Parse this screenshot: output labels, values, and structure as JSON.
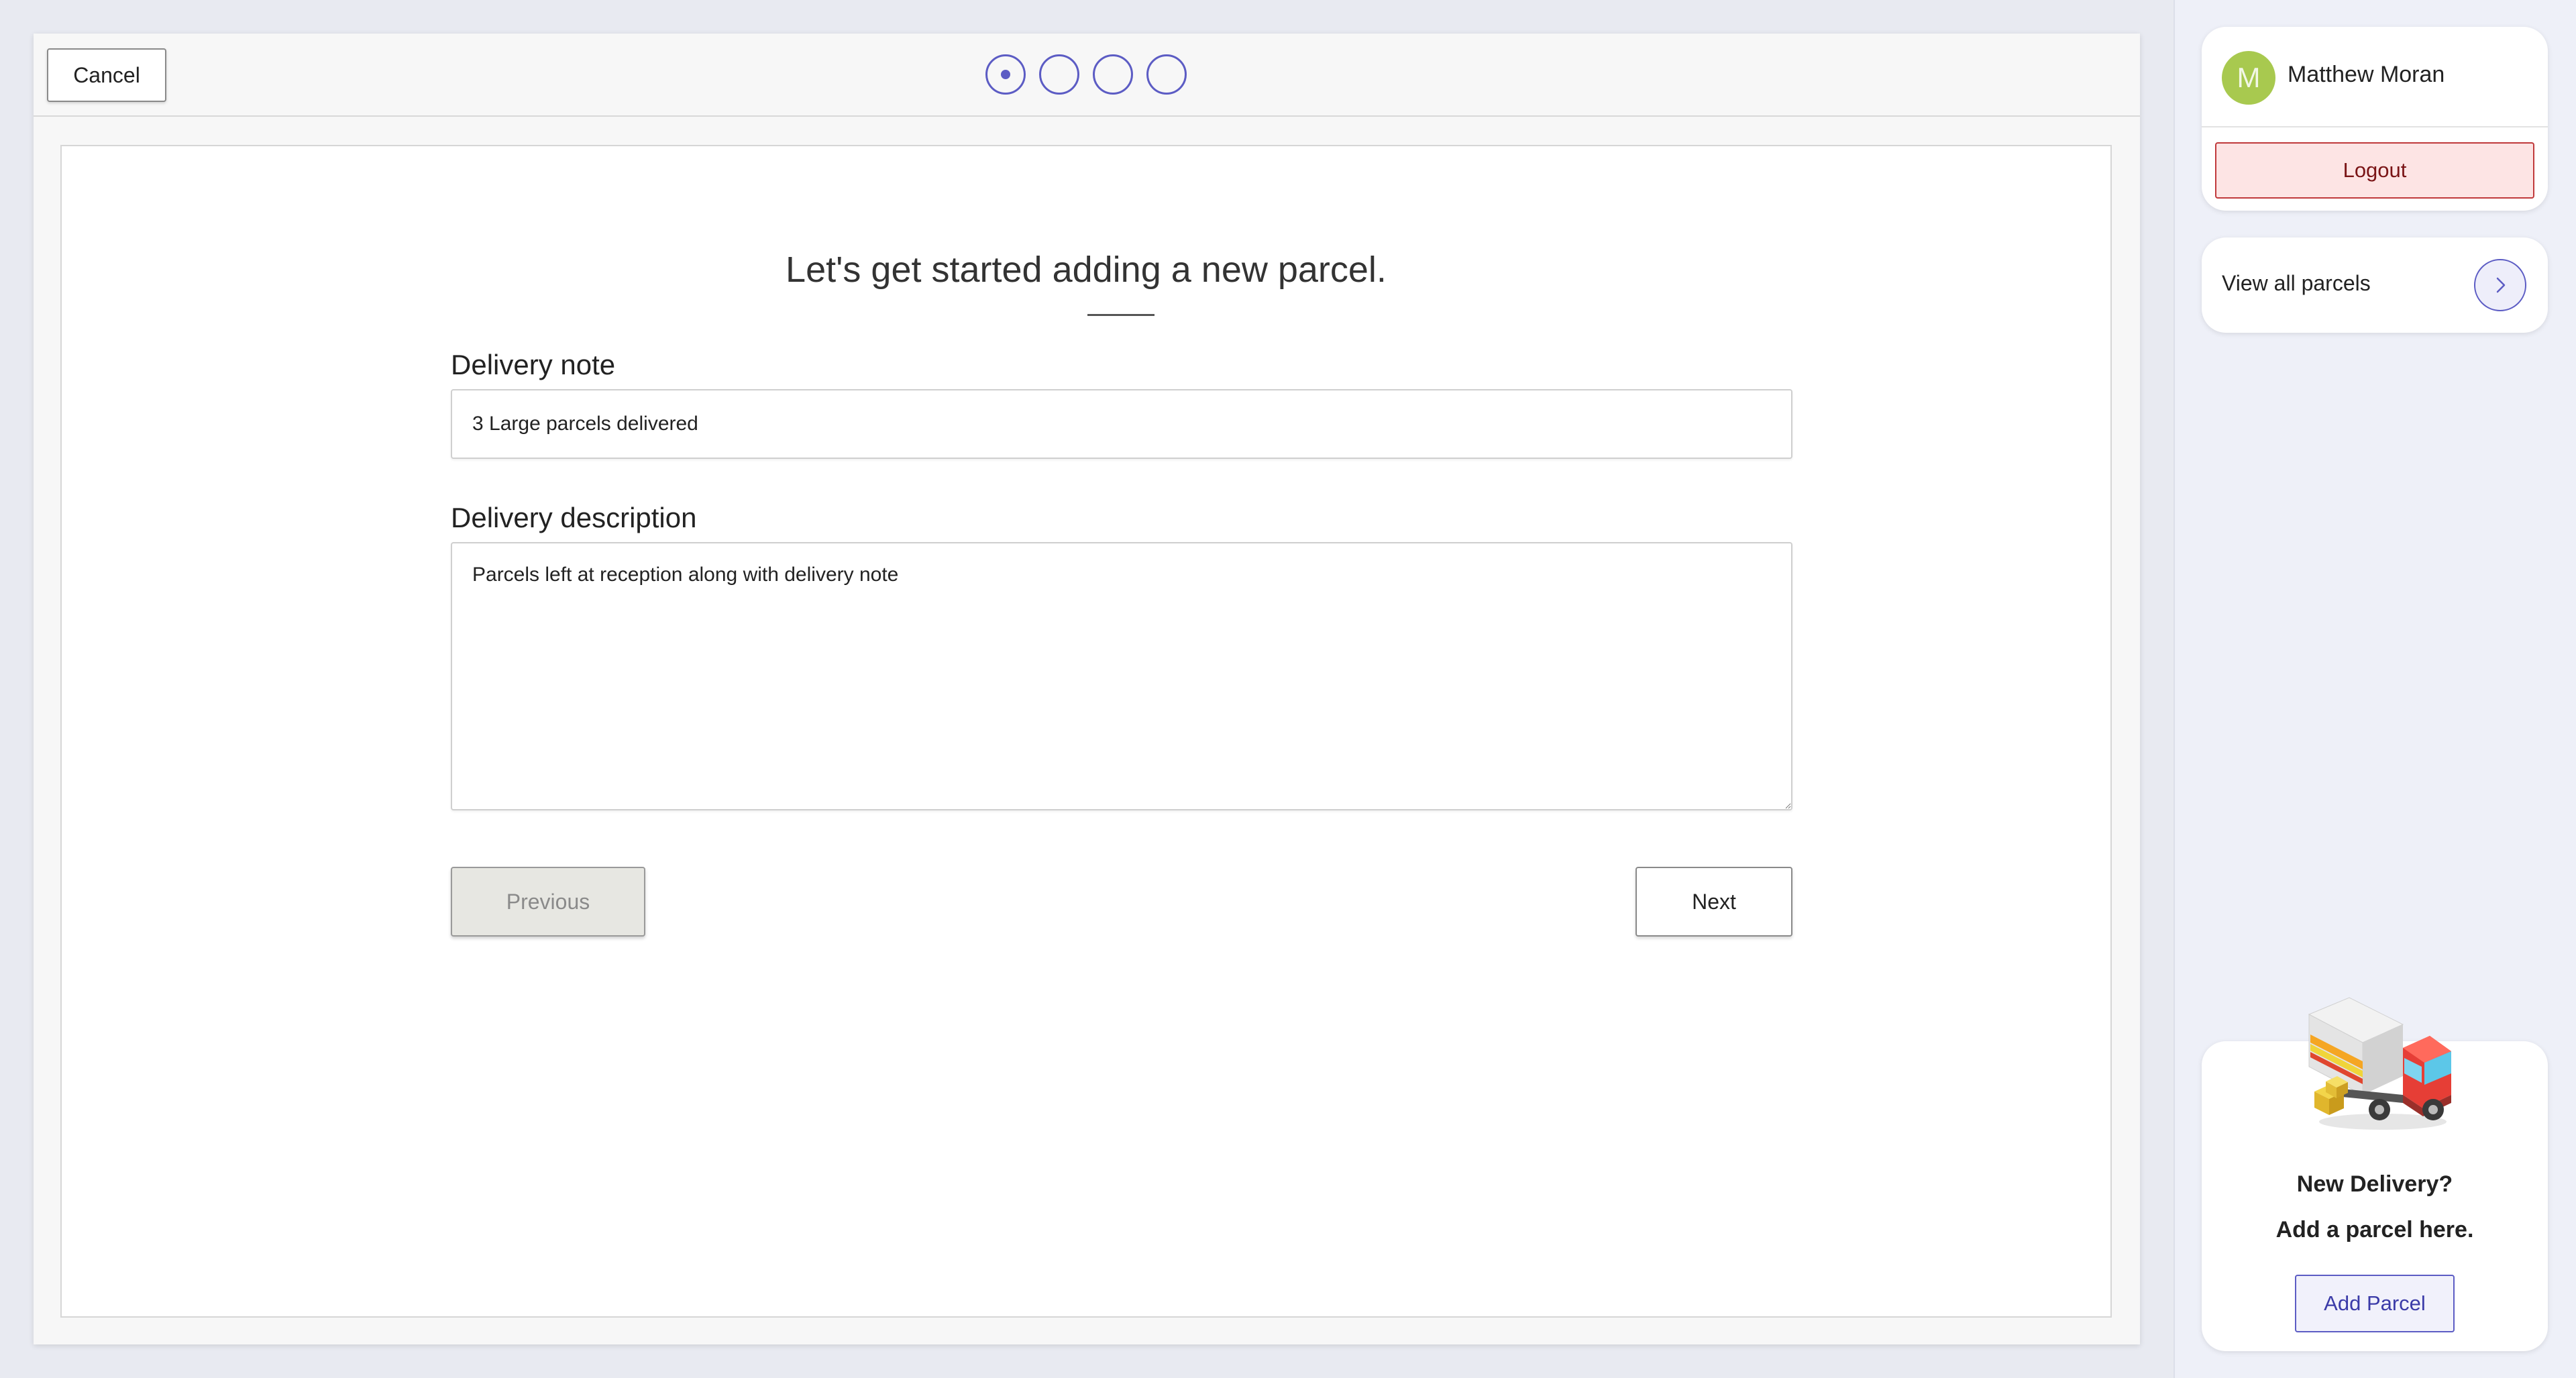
{
  "header": {
    "cancel_label": "Cancel",
    "step_count": 4,
    "active_step": 1
  },
  "form": {
    "title": "Let's get started adding a new parcel.",
    "delivery_note_label": "Delivery note",
    "delivery_note_value": "3 Large parcels delivered",
    "delivery_description_label": "Delivery description",
    "delivery_description_value": "Parcels left at reception along with delivery note",
    "previous_label": "Previous",
    "next_label": "Next"
  },
  "sidebar": {
    "user": {
      "initial": "M",
      "name": "Matthew Moran",
      "logout_label": "Logout"
    },
    "view_all_parcels_label": "View all parcels",
    "promo": {
      "line1": "New Delivery?",
      "line2": "Add a parcel here.",
      "button_label": "Add Parcel"
    }
  },
  "colors": {
    "accent": "#5c5cc4",
    "avatar": "#a8c94f",
    "logout_bg": "#fde4e4",
    "logout_border": "#c0393b",
    "background": "#e8eaf1"
  },
  "icons": {
    "steps": "step-indicator-icon",
    "chevron": "chevron-right-icon",
    "truck": "delivery-truck-icon"
  }
}
